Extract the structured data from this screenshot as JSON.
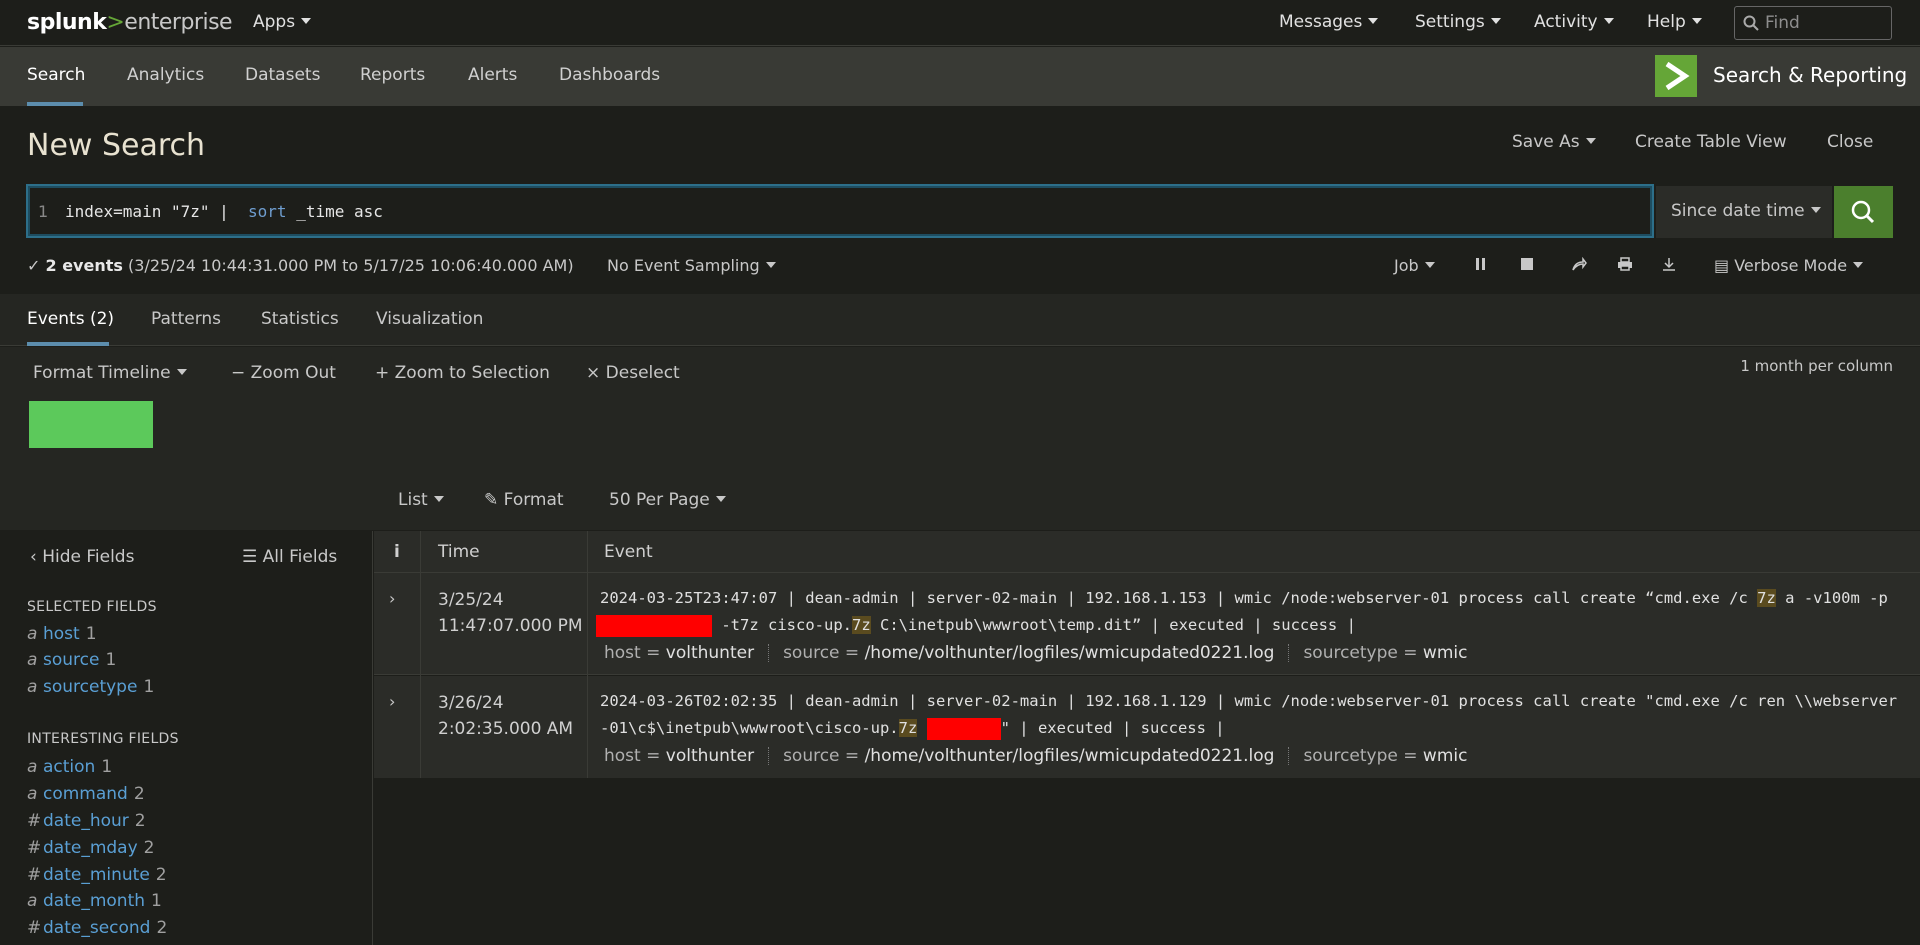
{
  "topbar": {
    "logo_brand": "splunk",
    "logo_sep": ">",
    "logo_product": "enterprise",
    "apps": "Apps",
    "nav": [
      "Messages",
      "Settings",
      "Activity",
      "Help"
    ],
    "find_placeholder": "Find"
  },
  "appnav": {
    "tabs": [
      "Search",
      "Analytics",
      "Datasets",
      "Reports",
      "Alerts",
      "Dashboards"
    ],
    "app_title": "Search & Reporting"
  },
  "header": {
    "title": "New Search",
    "save_as": "Save As",
    "create_table_view": "Create Table View",
    "close": "Close"
  },
  "search": {
    "line_number": "1",
    "query_part1": "index=main \"7z\" |  ",
    "query_kw": "sort",
    "query_part2": " _time asc",
    "time_range": "Since date time"
  },
  "status": {
    "check": "✓",
    "events_count": "2 events",
    "range": "(3/25/24 10:44:31.000 PM to 5/17/25 10:06:40.000 AM)",
    "sampling": "No Event Sampling",
    "job": "Job",
    "mode": "Verbose Mode"
  },
  "result_tabs": [
    "Events (2)",
    "Patterns",
    "Statistics",
    "Visualization"
  ],
  "timeline": {
    "format": "Format Timeline",
    "zoom_out": "Zoom Out",
    "zoom_selection": "Zoom to Selection",
    "deselect": "Deselect",
    "scale": "1 month per column",
    "list": "List",
    "format_btn": "Format",
    "per_page": "50 Per Page"
  },
  "sidebar": {
    "hide_fields": "Hide Fields",
    "all_fields": "All Fields",
    "selected_heading": "SELECTED FIELDS",
    "interesting_heading": "INTERESTING FIELDS",
    "selected": [
      {
        "type": "a",
        "name": "host",
        "count": "1"
      },
      {
        "type": "a",
        "name": "source",
        "count": "1"
      },
      {
        "type": "a",
        "name": "sourcetype",
        "count": "1"
      }
    ],
    "interesting": [
      {
        "type": "a",
        "name": "action",
        "count": "1"
      },
      {
        "type": "a",
        "name": "command",
        "count": "2"
      },
      {
        "type": "#",
        "name": "date_hour",
        "count": "2"
      },
      {
        "type": "#",
        "name": "date_mday",
        "count": "2"
      },
      {
        "type": "#",
        "name": "date_minute",
        "count": "2"
      },
      {
        "type": "a",
        "name": "date_month",
        "count": "1"
      },
      {
        "type": "#",
        "name": "date_second",
        "count": "2"
      }
    ]
  },
  "events": {
    "col_info": "i",
    "col_time": "Time",
    "col_event": "Event",
    "rows": [
      {
        "date": "3/25/24",
        "time": "11:47:07.000 PM",
        "raw_a": "2024-03-25T23:47:07 | dean-admin | server-02-main | 192.168.1.153 | wmic /node:webserver-01 process call create “cmd.exe /c ",
        "raw_hl1": "7z",
        "raw_b": " a -v100m -p",
        "raw_c": " -t7z cisco-up.",
        "raw_hl2": "7z",
        "raw_d": " C:\\inetpub\\wwwroot\\temp.dit” | executed | success |",
        "host": "volthunter",
        "source": "/home/volthunter/logfiles/wmicupdated0221.log",
        "sourcetype": "wmic"
      },
      {
        "date": "3/26/24",
        "time": "2:02:35.000 AM",
        "raw_a": "2024-03-26T02:02:35 | dean-admin | server-02-main | 192.168.1.129 | wmic /node:webserver-01 process call create \"cmd.exe /c ren \\\\webserver-01\\c$\\inetpub\\wwwroot\\cisco-up.",
        "raw_hl1": "7z",
        "raw_b": " ",
        "raw_c": "\" | executed | success |",
        "host": "volthunter",
        "source": "/home/volthunter/logfiles/wmicupdated0221.log",
        "sourcetype": "wmic"
      }
    ],
    "meta_host_key": "host =",
    "meta_source_key": "source =",
    "meta_sourcetype_key": "sourcetype ="
  },
  "colors": {
    "accent_blue": "#5c8dad",
    "brand_green": "#65a637",
    "timeline_green": "#5cc95b",
    "redaction": "#ff0000"
  }
}
